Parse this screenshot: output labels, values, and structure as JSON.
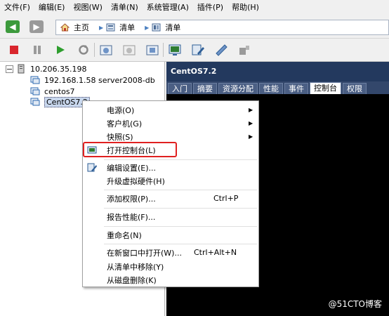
{
  "menubar": {
    "items": [
      "文件(F)",
      "编辑(E)",
      "视图(W)",
      "清单(N)",
      "系统管理(A)",
      "插件(P)",
      "帮助(H)"
    ]
  },
  "navbar": {
    "breadcrumbs": [
      {
        "label": "主页",
        "icon": "home-icon"
      },
      {
        "label": "清单",
        "icon": "inventory-icon"
      },
      {
        "label": "清单",
        "icon": "inventory-icon"
      }
    ]
  },
  "tree": {
    "host": "10.206.35.198",
    "vms": [
      "192.168.1.58  server2008-db",
      "centos7",
      "CentOS7.2"
    ]
  },
  "detail": {
    "title": "CentOS7.2",
    "tabs": [
      "入门",
      "摘要",
      "资源分配",
      "性能",
      "事件",
      "控制台",
      "权限"
    ],
    "active_tab": "控制台"
  },
  "context_menu": {
    "items": [
      {
        "label": "电源(O)",
        "submenu": true
      },
      {
        "label": "客户机(G)",
        "submenu": true
      },
      {
        "label": "快照(S)",
        "submenu": true
      },
      {
        "label": "打开控制台(L)",
        "highlighted": true
      },
      {
        "label": "编辑设置(E)..."
      },
      {
        "label": "升级虚拟硬件(H)"
      },
      {
        "label": "添加权限(P)...",
        "shortcut": "Ctrl+P"
      },
      {
        "label": "报告性能(F)..."
      },
      {
        "label": "重命名(N)"
      },
      {
        "label": "在新窗口中打开(W)...",
        "shortcut": "Ctrl+Alt+N"
      },
      {
        "label": "从清单中移除(Y)"
      },
      {
        "label": "从磁盘删除(K)"
      }
    ]
  },
  "watermark": "@51CTO博客",
  "colors": {
    "title_bar": "#23395e",
    "highlight_border": "#e02020",
    "console": "#000000"
  }
}
